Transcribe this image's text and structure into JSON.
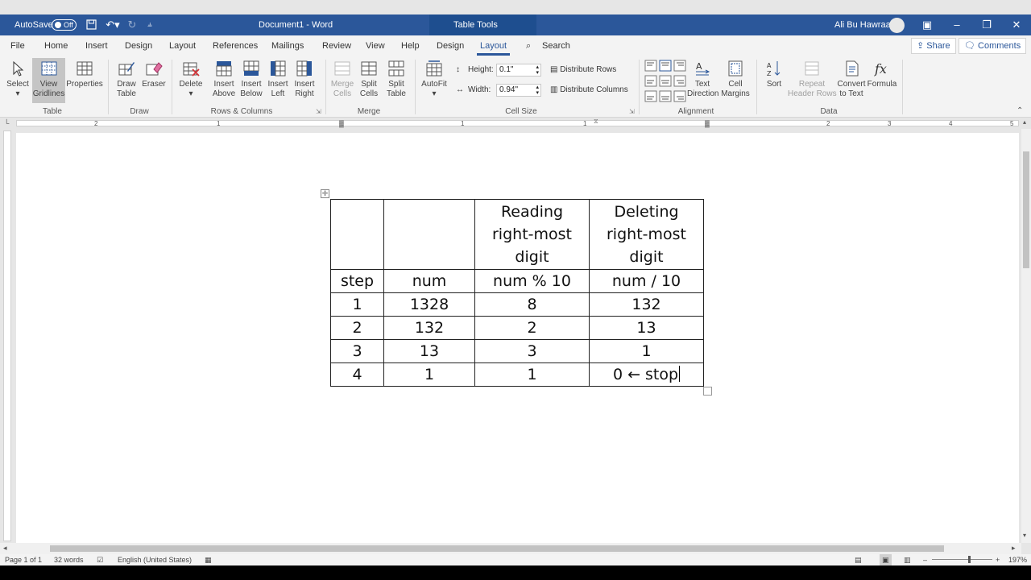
{
  "titlebar": {
    "autosave_label": "AutoSave",
    "autosave_state": "Off",
    "doc_title": "Document1  -  Word",
    "context_tab": "Table Tools",
    "user_name": "Ali Bu Hawraa"
  },
  "tabs": [
    "File",
    "Home",
    "Insert",
    "Design",
    "Layout",
    "References",
    "Mailings",
    "Review",
    "View",
    "Help",
    "Design",
    "Layout"
  ],
  "active_tab": "Layout",
  "search_label": "Search",
  "share_label": "Share",
  "comments_label": "Comments",
  "ribbon": {
    "table": {
      "select": "Select",
      "view_gridlines_1": "View",
      "view_gridlines_2": "Gridlines",
      "properties": "Properties",
      "group": "Table"
    },
    "draw": {
      "draw_table_1": "Draw",
      "draw_table_2": "Table",
      "eraser": "Eraser",
      "group": "Draw"
    },
    "rows_columns": {
      "delete": "Delete",
      "insert_above_1": "Insert",
      "insert_above_2": "Above",
      "insert_below_1": "Insert",
      "insert_below_2": "Below",
      "insert_left_1": "Insert",
      "insert_left_2": "Left",
      "insert_right_1": "Insert",
      "insert_right_2": "Right",
      "group": "Rows & Columns"
    },
    "merge": {
      "merge_cells_1": "Merge",
      "merge_cells_2": "Cells",
      "split_cells_1": "Split",
      "split_cells_2": "Cells",
      "split_table_1": "Split",
      "split_table_2": "Table",
      "group": "Merge"
    },
    "cell_size": {
      "autofit": "AutoFit",
      "height_label": "Height:",
      "height_value": "0.1\"",
      "width_label": "Width:",
      "width_value": "0.94\"",
      "distribute_rows": "Distribute Rows",
      "distribute_columns": "Distribute Columns",
      "group": "Cell Size"
    },
    "alignment": {
      "text_direction_1": "Text",
      "text_direction_2": "Direction",
      "cell_margins_1": "Cell",
      "cell_margins_2": "Margins",
      "group": "Alignment"
    },
    "data": {
      "sort": "Sort",
      "repeat_header_1": "Repeat",
      "repeat_header_2": "Header Rows",
      "convert_1": "Convert",
      "convert_2": "to Text",
      "formula": "Formula",
      "group": "Data"
    }
  },
  "ruler_numbers": [
    "2",
    "1",
    "1",
    "1",
    "2",
    "3",
    "4",
    "5"
  ],
  "table": {
    "header": [
      "",
      "",
      "Reading right-most digit",
      "Deleting right-most digit"
    ],
    "header_lines": [
      [],
      [],
      [
        "Reading",
        "right-most",
        "digit"
      ],
      [
        "Deleting",
        "right-most",
        "digit"
      ]
    ],
    "col_labels": [
      "step",
      "num",
      "num % 10",
      "num / 10"
    ],
    "rows": [
      [
        "1",
        "1328",
        "8",
        "132"
      ],
      [
        "2",
        "132",
        "2",
        "13"
      ],
      [
        "3",
        "13",
        "3",
        "1"
      ],
      [
        "4",
        "1",
        "1",
        "0 ← stop"
      ]
    ]
  },
  "statusbar": {
    "page": "Page 1 of 1",
    "words": "32 words",
    "language": "English (United States)",
    "zoom": "197%"
  },
  "colors": {
    "word_blue": "#2b579a",
    "ribbon_bg": "#f3f3f3"
  }
}
